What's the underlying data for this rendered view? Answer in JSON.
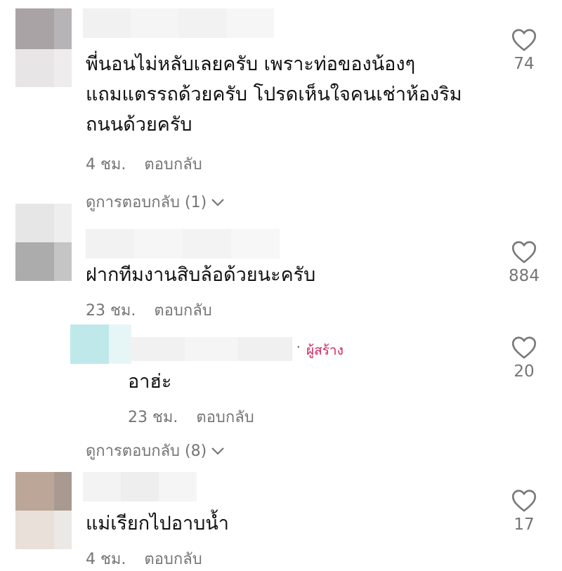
{
  "comments": [
    {
      "text_lines": [
        "พี่นอนไม่หลับเลยครับ เพราะท่อของน้องๆ",
        "แถมแตรรถด้วยครับ โปรดเห็นใจคนเช่าห้องริม",
        "ถนนด้วยครับ"
      ],
      "time": "4 ชม.",
      "reply_label": "ตอบกลับ",
      "likes": "74",
      "view_replies": "ดูการตอบกลับ (1)"
    },
    {
      "text_lines": [
        "ฝากทีมงานสิบล้อด้วยนะครับ"
      ],
      "time": "23 ชม.",
      "reply_label": "ตอบกลับ",
      "likes": "884",
      "reply": {
        "creator_label": "ผู้สร้าง",
        "text": "อาฮ่ะ",
        "time": "23 ชม.",
        "reply_label": "ตอบกลับ",
        "likes": "20"
      },
      "view_replies": "ดูการตอบกลับ (8)"
    },
    {
      "text_lines": [
        "แม่เรียกไปอาบน้ำ"
      ],
      "time": "4 ชม.",
      "reply_label": "ตอบกลับ",
      "likes": "17"
    }
  ],
  "colors": {
    "creator_badge": "#d0245a",
    "meta_text": "#757575"
  },
  "icons": {
    "like": "heart-outline-icon",
    "expand": "chevron-down-icon"
  }
}
